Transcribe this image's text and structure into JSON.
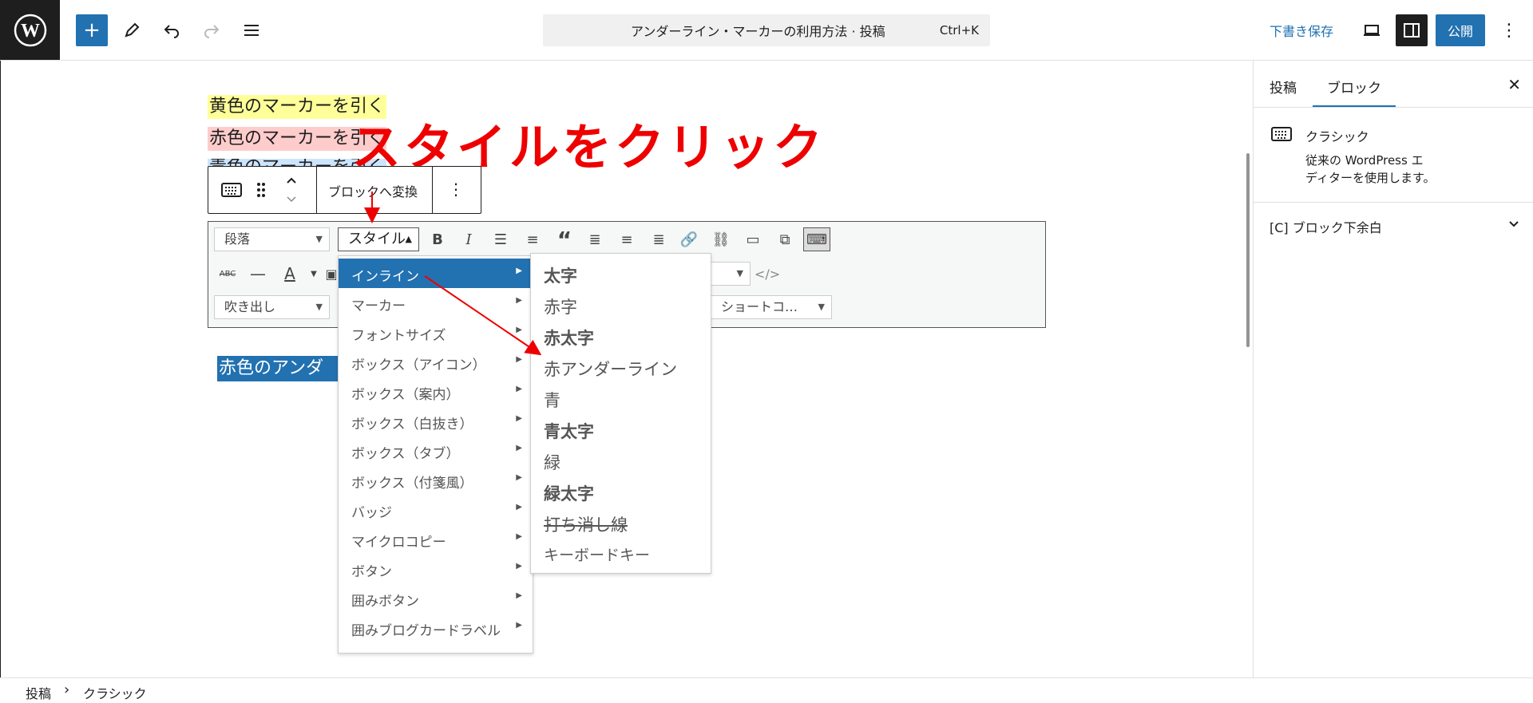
{
  "header": {
    "add_button": "+",
    "command_title": "アンダーライン・マーカーの利用方法 · 投稿",
    "command_shortcut": "Ctrl+K",
    "save_draft": "下書き保存",
    "publish": "公開",
    "more_icon": "⋮"
  },
  "sidebar": {
    "tabs": [
      "投稿",
      "ブロック"
    ],
    "active_tab": "ブロック",
    "close_icon": "✕",
    "block_name": "クラシック",
    "block_desc_1": "従来の WordPress エ",
    "block_desc_2": "ディターを使用します。",
    "panel_title": "[C] ブロック下余白"
  },
  "editor": {
    "line_yellow": "黄色のマーカーを引く",
    "line_red": "赤色のマーカーを引く",
    "line_blue": "青色のマーカーを引く",
    "selected_text": "赤色のアンダーライン",
    "annotation": "スタイルをクリック",
    "colors": {
      "yellow": "#ffff99",
      "red": "#ffcccc",
      "blue": "#cce5ff",
      "accent": "#2271b1",
      "annotation": "#e00000"
    }
  },
  "block_toolbar": {
    "transform": "ブロックへ変換",
    "more_icon": "⋮"
  },
  "classic_toolbar": {
    "format_select": "段落",
    "style_select": "スタイル",
    "balloon_select": "吹き出し",
    "shortcode_select": "ショートコ…"
  },
  "style_menu": {
    "items": [
      "インライン",
      "マーカー",
      "フォントサイズ",
      "ボックス（アイコン）",
      "ボックス（案内）",
      "ボックス（白抜き）",
      "ボックス（タブ）",
      "ボックス（付箋風）",
      "バッジ",
      "マイクロコピー",
      "ボタン",
      "囲みボタン",
      "囲みブログカードラベル"
    ],
    "active": "インライン"
  },
  "inline_submenu": {
    "items": [
      "太字",
      "赤字",
      "赤太字",
      "赤アンダーライン",
      "青",
      "青太字",
      "緑",
      "緑太字",
      "打ち消し線",
      "キーボードキー"
    ]
  },
  "footer": {
    "breadcrumb_1": "投稿",
    "separator": "›",
    "breadcrumb_2": "クラシック"
  }
}
